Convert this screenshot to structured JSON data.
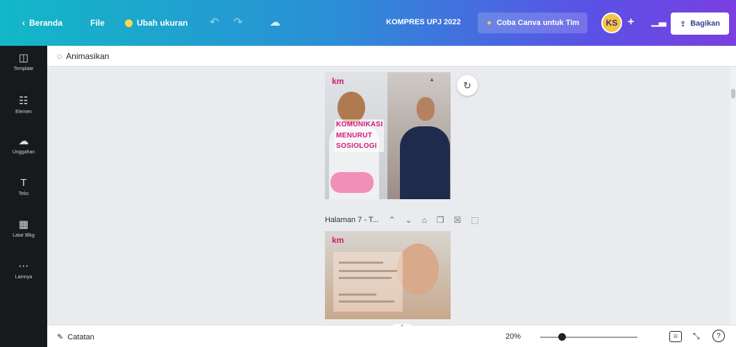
{
  "topbar": {
    "back_label": "Beranda",
    "file_label": "File",
    "resize_label": "Ubah ukuran",
    "doc_title": "KOMPRES UPJ 2022",
    "try_label": "Coba Canva untuk Tim",
    "avatar_initials": "KS",
    "share_label": "Bagikan"
  },
  "sidebar": {
    "items": [
      {
        "label": "Template",
        "icon": "template-icon"
      },
      {
        "label": "Elemen",
        "icon": "elements-icon"
      },
      {
        "label": "Unggahan",
        "icon": "upload-icon"
      },
      {
        "label": "Teks",
        "icon": "text-icon"
      },
      {
        "label": "Latar Blkg",
        "icon": "background-icon"
      },
      {
        "label": "Lainnya",
        "icon": "more-icon"
      }
    ]
  },
  "subbar": {
    "animate_label": "Animasikan"
  },
  "canvas": {
    "page1": {
      "logo": "km",
      "title_lines": [
        "KOMUNIKASI",
        "MENURUT",
        "SOSIOLOGI"
      ]
    },
    "page_control": {
      "label": "Halaman 7 - T..."
    },
    "page2": {
      "logo": "km"
    }
  },
  "bottombar": {
    "notes_label": "Catatan",
    "zoom": "20%",
    "zoom_level": 0.2
  },
  "colors": {
    "brand_pink": "#d4177a",
    "topbar_start": "#12b8c7",
    "topbar_end": "#7a3fe0"
  }
}
